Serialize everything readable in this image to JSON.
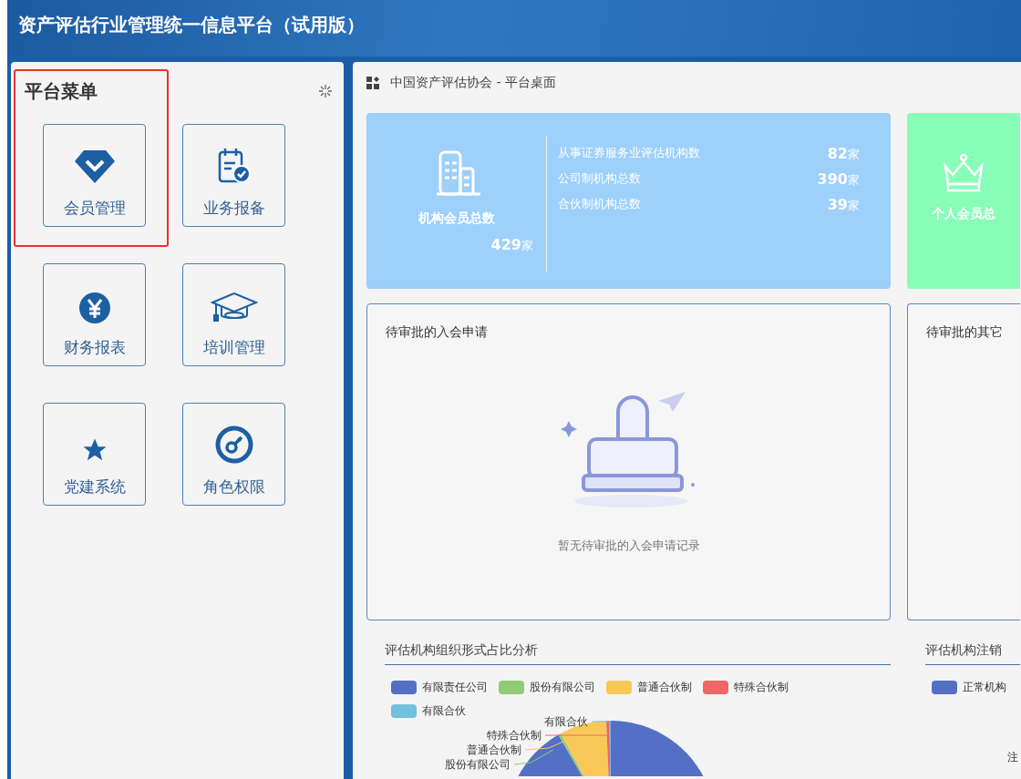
{
  "header": {
    "title": "资产评估行业管理统一信息平台（试用版）"
  },
  "sidebar": {
    "title": "平台菜单",
    "highlight_frame": true,
    "items": [
      {
        "label": "会员管理"
      },
      {
        "label": "业务报备"
      },
      {
        "label": "财务报表"
      },
      {
        "label": "培训管理"
      },
      {
        "label": "党建系统"
      },
      {
        "label": "角色权限"
      }
    ]
  },
  "breadcrumb": "中国资产评估协会 - 平台桌面",
  "org_card": {
    "title": "机构会员总数",
    "total": "429",
    "unit": "家",
    "rows": [
      {
        "label": "从事证券服务业评估机构数",
        "value": "82",
        "unit": "家"
      },
      {
        "label": "公司制机构总数",
        "value": "390",
        "unit": "家"
      },
      {
        "label": "合伙制机构总数",
        "value": "39",
        "unit": "家"
      }
    ]
  },
  "person_card": {
    "title": "个人会员总"
  },
  "pending_join": {
    "title": "待审批的入会申请",
    "empty_text": "暂无待审批的入会申请记录"
  },
  "pending_other": {
    "title": "待审批的其它"
  },
  "org_form_chart": {
    "title": "评估机构组织形式占比分析",
    "legend": [
      {
        "label": "有限责任公司",
        "color": "#5470c6"
      },
      {
        "label": "股份有限公司",
        "color": "#91cc75"
      },
      {
        "label": "普通合伙制",
        "color": "#fac858"
      },
      {
        "label": "特殊合伙制",
        "color": "#ee6666"
      },
      {
        "label": "有限合伙",
        "color": "#73c0de"
      }
    ],
    "pie_labels": [
      "有限合伙",
      "特殊合伙制",
      "普通合伙制",
      "股份有限公司"
    ]
  },
  "cancel_chart": {
    "title": "评估机构注销",
    "legend": [
      {
        "label": "正常机构",
        "color": "#5470c6"
      }
    ],
    "note": "注"
  }
}
